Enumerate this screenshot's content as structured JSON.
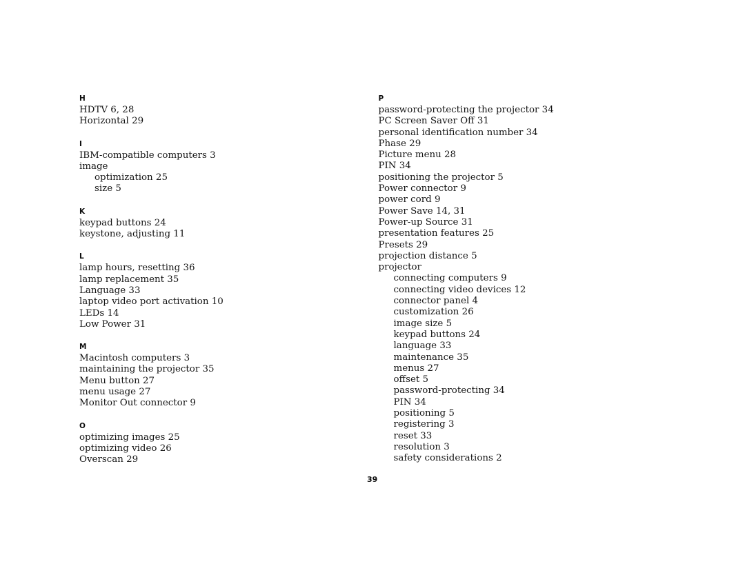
{
  "document": {
    "type": "index",
    "page_number": "39",
    "text_color": "#141414"
  },
  "columns": [
    {
      "side": "left",
      "groups": [
        {
          "letter": "H",
          "entries": [
            {
              "text": "HDTV 6, 28",
              "level": 0
            },
            {
              "text": "Horizontal 29",
              "level": 0
            }
          ]
        },
        {
          "letter": "I",
          "entries": [
            {
              "text": "IBM-compatible computers 3",
              "level": 0
            },
            {
              "text": "image",
              "level": 0
            },
            {
              "text": "optimization 25",
              "level": 1
            },
            {
              "text": "size 5",
              "level": 1
            }
          ]
        },
        {
          "letter": "K",
          "entries": [
            {
              "text": "keypad buttons 24",
              "level": 0
            },
            {
              "text": "keystone, adjusting 11",
              "level": 0
            }
          ]
        },
        {
          "letter": "L",
          "entries": [
            {
              "text": "lamp hours, resetting 36",
              "level": 0
            },
            {
              "text": "lamp replacement 35",
              "level": 0
            },
            {
              "text": "Language 33",
              "level": 0
            },
            {
              "text": "laptop video port activation 10",
              "level": 0
            },
            {
              "text": "LEDs 14",
              "level": 0
            },
            {
              "text": "Low Power 31",
              "level": 0
            }
          ]
        },
        {
          "letter": "M",
          "entries": [
            {
              "text": "Macintosh computers 3",
              "level": 0
            },
            {
              "text": "maintaining the projector 35",
              "level": 0
            },
            {
              "text": "Menu button 27",
              "level": 0
            },
            {
              "text": "menu usage 27",
              "level": 0
            },
            {
              "text": "Monitor Out connector 9",
              "level": 0
            }
          ]
        },
        {
          "letter": "O",
          "entries": [
            {
              "text": "optimizing images 25",
              "level": 0
            },
            {
              "text": "optimizing video 26",
              "level": 0
            },
            {
              "text": "Overscan 29",
              "level": 0
            }
          ]
        }
      ]
    },
    {
      "side": "right",
      "groups": [
        {
          "letter": "P",
          "entries": [
            {
              "text": "password-protecting the projector 34",
              "level": 0
            },
            {
              "text": "PC Screen Saver Off 31",
              "level": 0
            },
            {
              "text": "personal identification number 34",
              "level": 0
            },
            {
              "text": "Phase 29",
              "level": 0
            },
            {
              "text": "Picture menu 28",
              "level": 0
            },
            {
              "text": "PIN 34",
              "level": 0
            },
            {
              "text": "positioning the projector 5",
              "level": 0
            },
            {
              "text": "Power connector 9",
              "level": 0
            },
            {
              "text": "power cord 9",
              "level": 0
            },
            {
              "text": "Power Save 14, 31",
              "level": 0
            },
            {
              "text": "Power-up Source 31",
              "level": 0
            },
            {
              "text": "presentation features 25",
              "level": 0
            },
            {
              "text": "Presets 29",
              "level": 0
            },
            {
              "text": "projection distance 5",
              "level": 0
            },
            {
              "text": "projector",
              "level": 0
            },
            {
              "text": "connecting computers 9",
              "level": 1
            },
            {
              "text": "connecting video devices 12",
              "level": 1
            },
            {
              "text": "connector panel 4",
              "level": 1
            },
            {
              "text": "customization 26",
              "level": 1
            },
            {
              "text": "image size 5",
              "level": 1
            },
            {
              "text": "keypad buttons 24",
              "level": 1
            },
            {
              "text": "language 33",
              "level": 1
            },
            {
              "text": "maintenance 35",
              "level": 1
            },
            {
              "text": "menus 27",
              "level": 1
            },
            {
              "text": "offset 5",
              "level": 1
            },
            {
              "text": "password-protecting 34",
              "level": 1
            },
            {
              "text": "PIN 34",
              "level": 1
            },
            {
              "text": "positioning 5",
              "level": 1
            },
            {
              "text": "registering 3",
              "level": 1
            },
            {
              "text": "reset 33",
              "level": 1
            },
            {
              "text": "resolution 3",
              "level": 1
            },
            {
              "text": "safety considerations 2",
              "level": 1
            }
          ]
        }
      ]
    }
  ]
}
